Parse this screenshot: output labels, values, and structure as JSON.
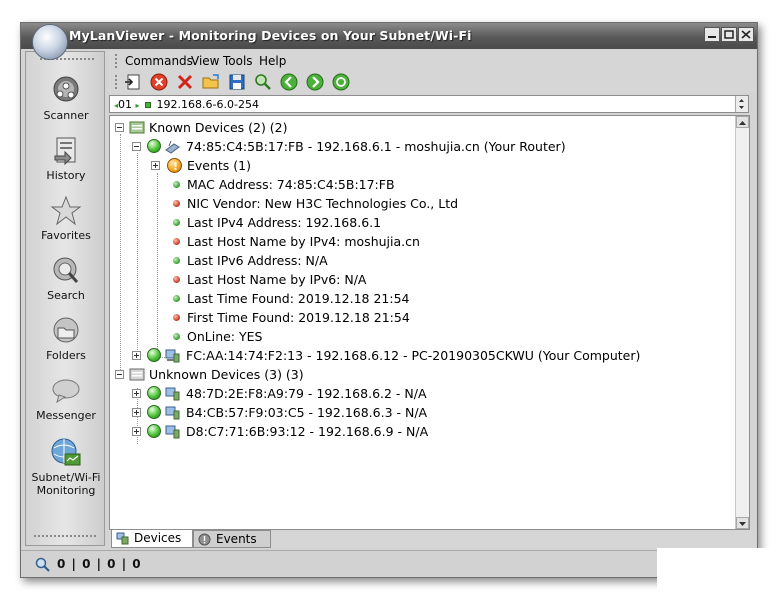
{
  "window": {
    "title": "MyLanViewer - Monitoring Devices on Your Subnet/Wi-Fi"
  },
  "sidebar": {
    "items": [
      {
        "label": "Scanner",
        "icon": "scanner-icon"
      },
      {
        "label": "History",
        "icon": "history-icon"
      },
      {
        "label": "Favorites",
        "icon": "star-icon"
      },
      {
        "label": "Search",
        "icon": "search-icon"
      },
      {
        "label": "Folders",
        "icon": "folders-icon"
      },
      {
        "label": "Messenger",
        "icon": "messenger-icon"
      },
      {
        "label": "Subnet/Wi-Fi",
        "label2": "Monitoring",
        "icon": "monitoring-icon"
      }
    ]
  },
  "menu": {
    "items": [
      "Commands",
      "View",
      "Tools",
      "Help"
    ]
  },
  "toolbar": {
    "buttons": [
      "import-icon",
      "stop-icon",
      "delete-icon",
      "open-icon",
      "save-icon",
      "find-icon",
      "back-icon",
      "forward-icon",
      "refresh-icon"
    ]
  },
  "address": {
    "prefix": "01",
    "value": "192.168.6-6.0-254"
  },
  "tree": {
    "known": {
      "label": "Known Devices (2) (2)",
      "router": {
        "label": "74:85:C4:5B:17:FB - 192.168.6.1 - moshujia.cn (Your Router)",
        "events": "Events (1)",
        "props": [
          {
            "text": "MAC Address: 74:85:C4:5B:17:FB",
            "status": "green"
          },
          {
            "text": "NIC Vendor: New H3C Technologies Co., Ltd",
            "status": "red"
          },
          {
            "text": "Last IPv4 Address: 192.168.6.1",
            "status": "green"
          },
          {
            "text": "Last Host Name by IPv4: moshujia.cn",
            "status": "red"
          },
          {
            "text": "Last IPv6 Address: N/A",
            "status": "green"
          },
          {
            "text": "Last Host Name by IPv6: N/A",
            "status": "red"
          },
          {
            "text": "Last Time Found: 2019.12.18  21:54",
            "status": "green"
          },
          {
            "text": "First Time Found: 2019.12.18  21:54",
            "status": "red"
          },
          {
            "text": "OnLine: YES",
            "status": "green"
          }
        ]
      },
      "computer": "FC:AA:14:74:F2:13 - 192.168.6.12 - PC-20190305CKWU (Your Computer)"
    },
    "unknown": {
      "label": "Unknown Devices (3) (3)",
      "devices": [
        "48:7D:2E:F8:A9:79 - 192.168.6.2 - N/A",
        "B4:CB:57:F9:03:C5 - 192.168.6.3 - N/A",
        "D8:C7:71:6B:93:12 - 192.168.6.9 - N/A"
      ]
    }
  },
  "tabs": {
    "devices": "Devices",
    "events": "Events"
  },
  "status": {
    "text": "0 | 0 | 0 | 0"
  },
  "colors": {
    "status_green": "#2e9b2a",
    "status_red": "#c0341c",
    "titlebar": "#595959"
  }
}
